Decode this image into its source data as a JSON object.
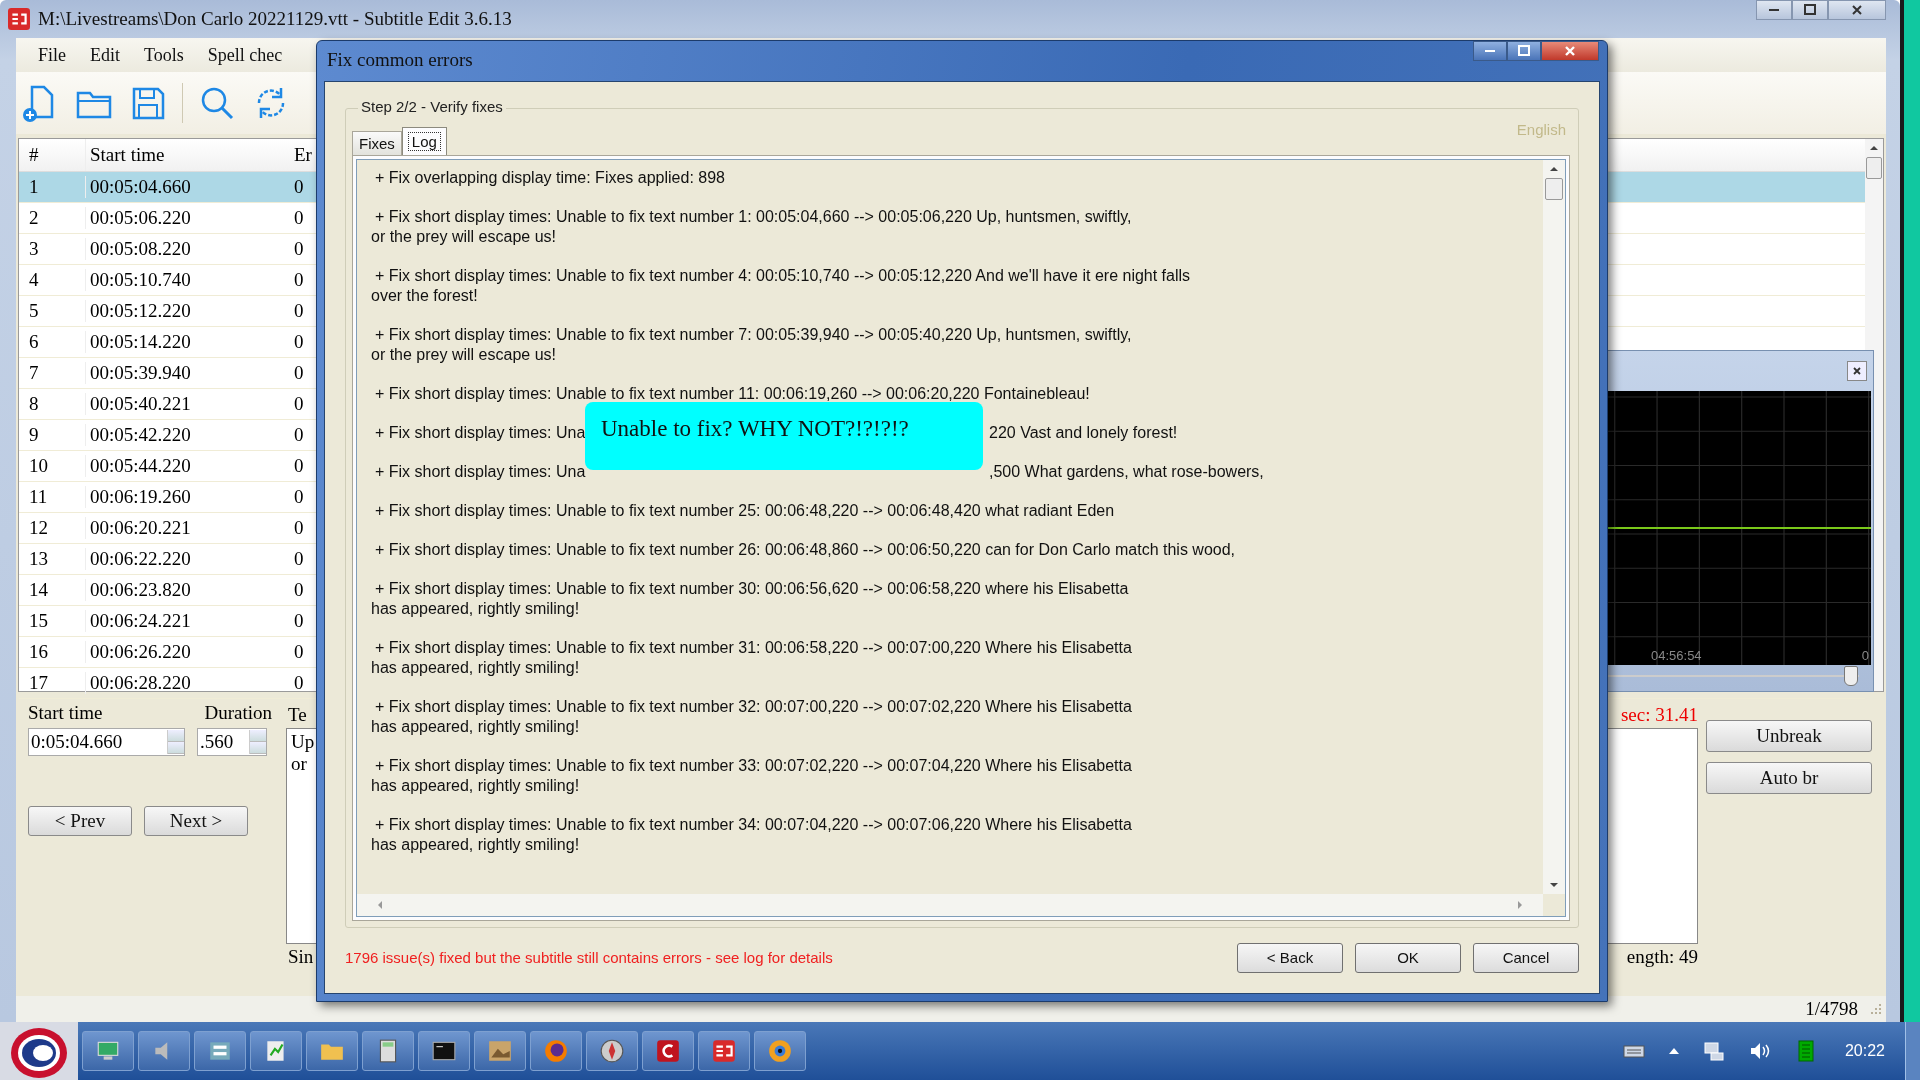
{
  "main_window": {
    "title": "M:\\Livestreams\\Don Carlo 20221129.vtt - Subtitle Edit 3.6.13",
    "menu": [
      "File",
      "Edit",
      "Tools",
      "Spell chec"
    ],
    "subtitle_table": {
      "columns": [
        "#",
        "Start time",
        "Er"
      ],
      "rows": [
        {
          "number": "1",
          "start": "00:05:04.660",
          "column_3": "0",
          "selected": true
        },
        {
          "number": "2",
          "start": "00:05:06.220",
          "column_3": "0",
          "selected": false
        },
        {
          "number": "3",
          "start": "00:05:08.220",
          "column_3": "0",
          "selected": false
        },
        {
          "number": "4",
          "start": "00:05:10.740",
          "column_3": "0",
          "selected": false
        },
        {
          "number": "5",
          "start": "00:05:12.220",
          "column_3": "0",
          "selected": false
        },
        {
          "number": "6",
          "start": "00:05:14.220",
          "column_3": "0",
          "selected": false
        },
        {
          "number": "7",
          "start": "00:05:39.940",
          "column_3": "0",
          "selected": false
        },
        {
          "number": "8",
          "start": "00:05:40.221",
          "column_3": "0",
          "selected": false
        },
        {
          "number": "9",
          "start": "00:05:42.220",
          "column_3": "0",
          "selected": false
        },
        {
          "number": "10",
          "start": "00:05:44.220",
          "column_3": "0",
          "selected": false
        },
        {
          "number": "11",
          "start": "00:06:19.260",
          "column_3": "0",
          "selected": false
        },
        {
          "number": "12",
          "start": "00:06:20.221",
          "column_3": "0",
          "selected": false
        },
        {
          "number": "13",
          "start": "00:06:22.220",
          "column_3": "0",
          "selected": false
        },
        {
          "number": "14",
          "start": "00:06:23.820",
          "column_3": "0",
          "selected": false
        },
        {
          "number": "15",
          "start": "00:06:24.221",
          "column_3": "0",
          "selected": false
        },
        {
          "number": "16",
          "start": "00:06:26.220",
          "column_3": "0",
          "selected": false
        },
        {
          "number": "17",
          "start": "00:06:28.220",
          "column_3": "0",
          "selected": false
        }
      ]
    },
    "editor": {
      "start_time_label": "Start time",
      "duration_label": "Duration",
      "start_time": "0:05:04.660",
      "duration": ".560",
      "text_label": "Te",
      "text_lines": [
        "Up",
        "or"
      ],
      "chars_per_sec": "sec: 31.41",
      "single_line_label": "Sin",
      "line_length": "ength: 49",
      "prev_button": "< Prev",
      "next_button": "Next >",
      "unbreak_button": "Unbreak",
      "auto_break_button": "Auto br"
    },
    "waveform": {
      "time_label": "04:56:54",
      "edge_label": "0",
      "zoom": {
        "level": 0.97
      }
    },
    "status_bar": {
      "position": "1/4798"
    }
  },
  "dialog": {
    "title": "Fix common errors",
    "group_label": "Step 2/2 - Verify fixes",
    "language": "English",
    "tabs": [
      {
        "label": "Fixes",
        "selected": false
      },
      {
        "label": "Log",
        "selected": true
      }
    ],
    "log": [
      {
        "kind": "entry",
        "lines": [
          "+ Fix overlapping display time: Fixes applied: 898"
        ]
      },
      {
        "kind": "entry",
        "lines": [
          "+ Fix short display times: Unable to fix text number 1: 00:05:04,660 --> 00:05:06,220 Up, huntsmen, swiftly,",
          "or the prey will escape us!"
        ]
      },
      {
        "kind": "entry",
        "lines": [
          "+ Fix short display times: Unable to fix text number 4: 00:05:10,740 --> 00:05:12,220 And we'll have it ere night falls",
          "over the forest!"
        ]
      },
      {
        "kind": "entry",
        "lines": [
          "+ Fix short display times: Unable to fix text number 7: 00:05:39,940 --> 00:05:40,220 Up, huntsmen, swiftly,",
          "or the prey will escape us!"
        ]
      },
      {
        "kind": "entry",
        "lines": [
          "+ Fix short display times: Unable to fix text number 11: 00:06:19,260 --> 00:06:20,220 Fontainebleau!"
        ]
      },
      {
        "kind": "covered",
        "left": "+ Fix short display times: Una",
        "right": "220 Vast and lonely forest!"
      },
      {
        "kind": "covered",
        "left": "+ Fix short display times: Una",
        "right": ",500 What gardens, what rose-bowers,"
      },
      {
        "kind": "entry",
        "lines": [
          "+ Fix short display times: Unable to fix text number 25: 00:06:48,220 --> 00:06:48,420 what radiant Eden"
        ]
      },
      {
        "kind": "entry",
        "lines": [
          "+ Fix short display times: Unable to fix text number 26: 00:06:48,860 --> 00:06:50,220 can for Don Carlo match this wood,"
        ]
      },
      {
        "kind": "entry",
        "lines": [
          "+ Fix short display times: Unable to fix text number 30: 00:06:56,620 --> 00:06:58,220 where his Elisabetta",
          "has appeared, rightly smiling!"
        ]
      },
      {
        "kind": "entry",
        "lines": [
          "+ Fix short display times: Unable to fix text number 31: 00:06:58,220 --> 00:07:00,220 Where his Elisabetta",
          "has appeared, rightly smiling!"
        ]
      },
      {
        "kind": "entry",
        "lines": [
          "+ Fix short display times: Unable to fix text number 32: 00:07:00,220 --> 00:07:02,220 Where his Elisabetta",
          "has appeared, rightly smiling!"
        ]
      },
      {
        "kind": "entry",
        "lines": [
          "+ Fix short display times: Unable to fix text number 33: 00:07:02,220 --> 00:07:04,220 Where his Elisabetta",
          "has appeared, rightly smiling!"
        ]
      },
      {
        "kind": "entry",
        "lines": [
          "+ Fix short display times: Unable to fix text number 34: 00:07:04,220 --> 00:07:06,220 Where his Elisabetta",
          "has appeared, rightly smiling!"
        ]
      }
    ],
    "annotation": "Unable to fix?  WHY NOT?!?!?!?",
    "message": "1796 issue(s) fixed but the subtitle still contains errors - see log for details",
    "buttons": [
      "< Back",
      "OK",
      "Cancel"
    ]
  },
  "taskbar": {
    "clock": "20:22"
  }
}
